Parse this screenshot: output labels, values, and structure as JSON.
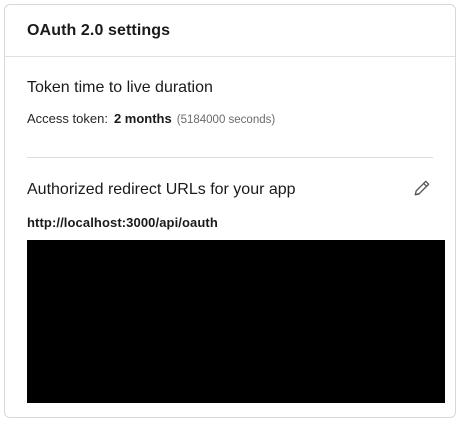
{
  "card": {
    "title": "OAuth 2.0 settings"
  },
  "token_section": {
    "heading": "Token time to live duration",
    "access_token_label": "Access token:",
    "access_token_value": "2 months",
    "access_token_seconds": "(5184000 seconds)"
  },
  "redirect_section": {
    "heading": "Authorized redirect URLs for your app",
    "edit_icon": "pencil-icon",
    "urls": [
      "http://localhost:3000/api/oauth"
    ]
  },
  "colors": {
    "redacted": "#000000",
    "border": "#d8d8d8",
    "secondary_text": "#6b6b6b"
  }
}
